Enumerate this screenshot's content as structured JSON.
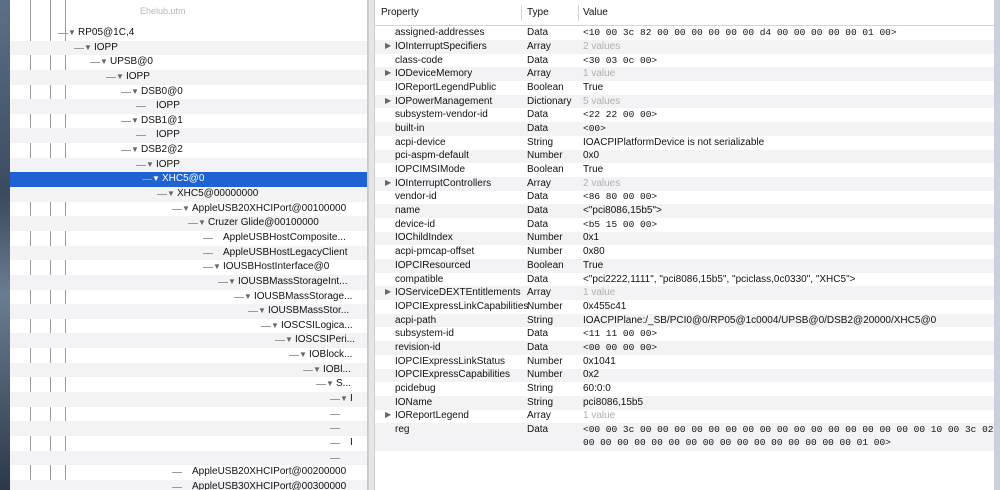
{
  "tree": {
    "faded_top": "Ehelub.utm",
    "rows": [
      {
        "label": "RP05@1C,4",
        "tri": "▼"
      },
      {
        "label": "IOPP",
        "tri": "▼"
      },
      {
        "label": "UPSB@0",
        "tri": "▼"
      },
      {
        "label": "IOPP",
        "tri": "▼"
      },
      {
        "label": "DSB0@0",
        "tri": "▼"
      },
      {
        "label": "IOPP",
        "tri": ""
      },
      {
        "label": "DSB1@1",
        "tri": "▼"
      },
      {
        "label": "IOPP",
        "tri": ""
      },
      {
        "label": "DSB2@2",
        "tri": "▼"
      },
      {
        "label": "IOPP",
        "tri": "▼"
      },
      {
        "label": "XHC5@0",
        "tri": "▼"
      },
      {
        "label": "XHC5@00000000",
        "tri": "▼"
      },
      {
        "label": "AppleUSB20XHCIPort@00100000",
        "tri": "▼"
      },
      {
        "label": "Cruzer Glide@00100000",
        "tri": "▼"
      },
      {
        "label": "AppleUSBHostComposite...",
        "tri": ""
      },
      {
        "label": "AppleUSBHostLegacyClient",
        "tri": ""
      },
      {
        "label": "IOUSBHostInterface@0",
        "tri": "▼"
      },
      {
        "label": "IOUSBMassStorageInt...",
        "tri": "▼"
      },
      {
        "label": "IOUSBMassStorage...",
        "tri": "▼"
      },
      {
        "label": "IOUSBMassStor...",
        "tri": "▼"
      },
      {
        "label": "IOSCSILogica...",
        "tri": "▼"
      },
      {
        "label": "IOSCSIPeri...",
        "tri": "▼"
      },
      {
        "label": "IOBlock...",
        "tri": "▼"
      },
      {
        "label": "IOBl...",
        "tri": "▼"
      },
      {
        "label": "S...",
        "tri": "▼"
      },
      {
        "label": "I",
        "tri": "▼"
      },
      {
        "label": "",
        "tri": ""
      },
      {
        "label": "",
        "tri": ""
      },
      {
        "label": "I",
        "tri": ""
      },
      {
        "label": "",
        "tri": ""
      },
      {
        "label": "AppleUSB20XHCIPort@00200000",
        "tri": ""
      },
      {
        "label": "AppleUSB30XHCIPort@00300000",
        "tri": ""
      },
      {
        "label": "AppleUSB30XHCIPort@00400000",
        "tri": ""
      }
    ]
  },
  "table": {
    "headers": {
      "property": "Property",
      "type": "Type",
      "value": "Value"
    },
    "rows": [
      {
        "name": "assigned-addresses",
        "type": "Data",
        "value": "<10 00 3c 82 00 00 00 00 00 00 d4 00 00 00 00 00 01 00>",
        "tri": "",
        "mono": true
      },
      {
        "name": "IOInterruptSpecifiers",
        "type": "Array",
        "value": "2 values",
        "tri": "▶",
        "gray": true
      },
      {
        "name": "class-code",
        "type": "Data",
        "value": "<30 03 0c 00>",
        "tri": "",
        "mono": true
      },
      {
        "name": "IODeviceMemory",
        "type": "Array",
        "value": "1 value",
        "tri": "▶",
        "gray": true
      },
      {
        "name": "IOReportLegendPublic",
        "type": "Boolean",
        "value": "True",
        "tri": ""
      },
      {
        "name": "IOPowerManagement",
        "type": "Dictionary",
        "value": "5 values",
        "tri": "▶",
        "gray": true
      },
      {
        "name": "subsystem-vendor-id",
        "type": "Data",
        "value": "<22 22 00 00>",
        "tri": "",
        "mono": true
      },
      {
        "name": "built-in",
        "type": "Data",
        "value": "<00>",
        "tri": "",
        "mono": true
      },
      {
        "name": "acpi-device",
        "type": "String",
        "value": "IOACPIPlatformDevice is not serializable",
        "tri": ""
      },
      {
        "name": "pci-aspm-default",
        "type": "Number",
        "value": "0x0",
        "tri": ""
      },
      {
        "name": "IOPCIMSIMode",
        "type": "Boolean",
        "value": "True",
        "tri": ""
      },
      {
        "name": "IOInterruptControllers",
        "type": "Array",
        "value": "2 values",
        "tri": "▶",
        "gray": true
      },
      {
        "name": "vendor-id",
        "type": "Data",
        "value": "<86 80 00 00>",
        "tri": "",
        "mono": true
      },
      {
        "name": "name",
        "type": "Data",
        "value": "<\"pci8086,15b5\">",
        "tri": ""
      },
      {
        "name": "device-id",
        "type": "Data",
        "value": "<b5 15 00 00>",
        "tri": "",
        "mono": true
      },
      {
        "name": "IOChildIndex",
        "type": "Number",
        "value": "0x1",
        "tri": ""
      },
      {
        "name": "acpi-pmcap-offset",
        "type": "Number",
        "value": "0x80",
        "tri": ""
      },
      {
        "name": "IOPCIResourced",
        "type": "Boolean",
        "value": "True",
        "tri": ""
      },
      {
        "name": "compatible",
        "type": "Data",
        "value": "<\"pci2222,1111\", \"pci8086,15b5\", \"pciclass,0c0330\", \"XHC5\">",
        "tri": ""
      },
      {
        "name": "IOServiceDEXTEntitlements",
        "type": "Array",
        "value": "1 value",
        "tri": "▶",
        "gray": true
      },
      {
        "name": "IOPCIExpressLinkCapabilities",
        "type": "Number",
        "value": "0x455c41",
        "tri": ""
      },
      {
        "name": "acpi-path",
        "type": "String",
        "value": "IOACPIPlane:/_SB/PCI0@0/RP05@1c0004/UPSB@0/DSB2@20000/XHC5@0",
        "tri": ""
      },
      {
        "name": "subsystem-id",
        "type": "Data",
        "value": "<11 11 00 00>",
        "tri": "",
        "mono": true
      },
      {
        "name": "revision-id",
        "type": "Data",
        "value": "<00 00 00 00>",
        "tri": "",
        "mono": true
      },
      {
        "name": "IOPCIExpressLinkStatus",
        "type": "Number",
        "value": "0x1041",
        "tri": ""
      },
      {
        "name": "IOPCIExpressCapabilities",
        "type": "Number",
        "value": "0x2",
        "tri": ""
      },
      {
        "name": "pcidebug",
        "type": "String",
        "value": "60:0:0",
        "tri": ""
      },
      {
        "name": "IOName",
        "type": "String",
        "value": "pci8086,15b5",
        "tri": ""
      },
      {
        "name": "IOReportLegend",
        "type": "Array",
        "value": "1 value",
        "tri": "▶",
        "gray": true
      },
      {
        "name": "reg",
        "type": "Data",
        "value": "<00 00 3c 00 00 00 00 00 00 00 00 00 00 00 00 00 00 00 00 00 10 00 3c 02",
        "value2": "00 00 00 00 00 00 00 00 00 00 00 00 00 00 00 00 01 00>",
        "tri": "",
        "mono": true
      }
    ]
  }
}
